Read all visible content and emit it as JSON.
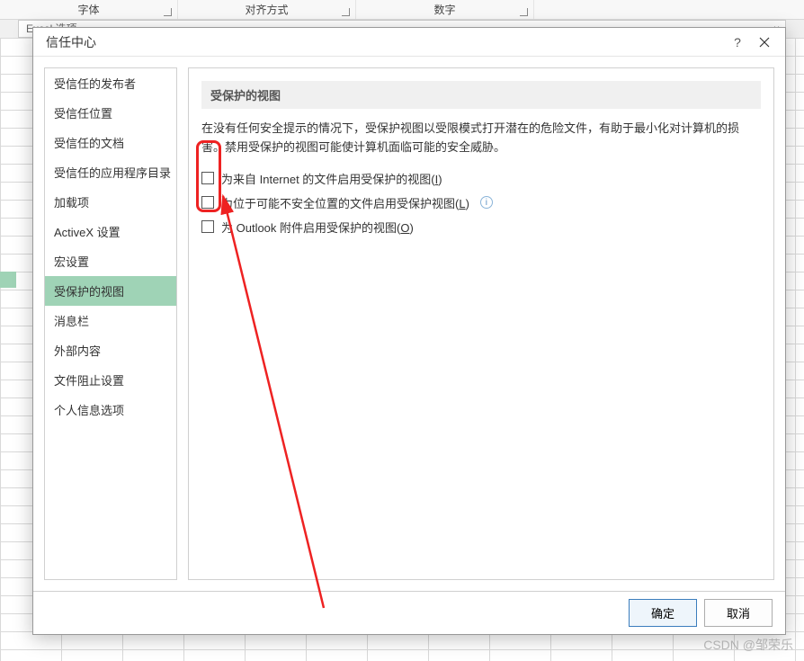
{
  "ribbon": {
    "groups": [
      "字体",
      "对齐方式",
      "数字"
    ]
  },
  "excel_options": {
    "title": "Excel 选项",
    "close": "×"
  },
  "dialog": {
    "title": "信任中心",
    "help": "?",
    "close": "×",
    "sidebar": {
      "items": [
        "受信任的发布者",
        "受信任位置",
        "受信任的文档",
        "受信任的应用程序目录",
        "加载项",
        "ActiveX 设置",
        "宏设置",
        "受保护的视图",
        "消息栏",
        "外部内容",
        "文件阻止设置",
        "个人信息选项"
      ],
      "selected_index": 7
    },
    "content": {
      "section_title": "受保护的视图",
      "description": "在没有任何安全提示的情况下，受保护视图以受限模式打开潜在的危险文件，有助于最小化对计算机的损害。禁用受保护的视图可能使计算机面临可能的安全威胁。",
      "options": [
        {
          "label_pre": "为来自 Internet 的文件启用受保护的视图(",
          "hotkey": "I",
          "label_post": ")",
          "info": false,
          "checked": false
        },
        {
          "label_pre": "为位于可能不安全位置的文件启用受保护视图(",
          "hotkey": "L",
          "label_post": ")",
          "info": true,
          "checked": false
        },
        {
          "label_pre": "为 Outlook 附件启用受保护的视图(",
          "hotkey": "O",
          "label_post": ")",
          "info": false,
          "checked": false
        }
      ]
    },
    "buttons": {
      "ok": "确定",
      "cancel": "取消"
    }
  },
  "watermark": "CSDN @邹荣乐"
}
